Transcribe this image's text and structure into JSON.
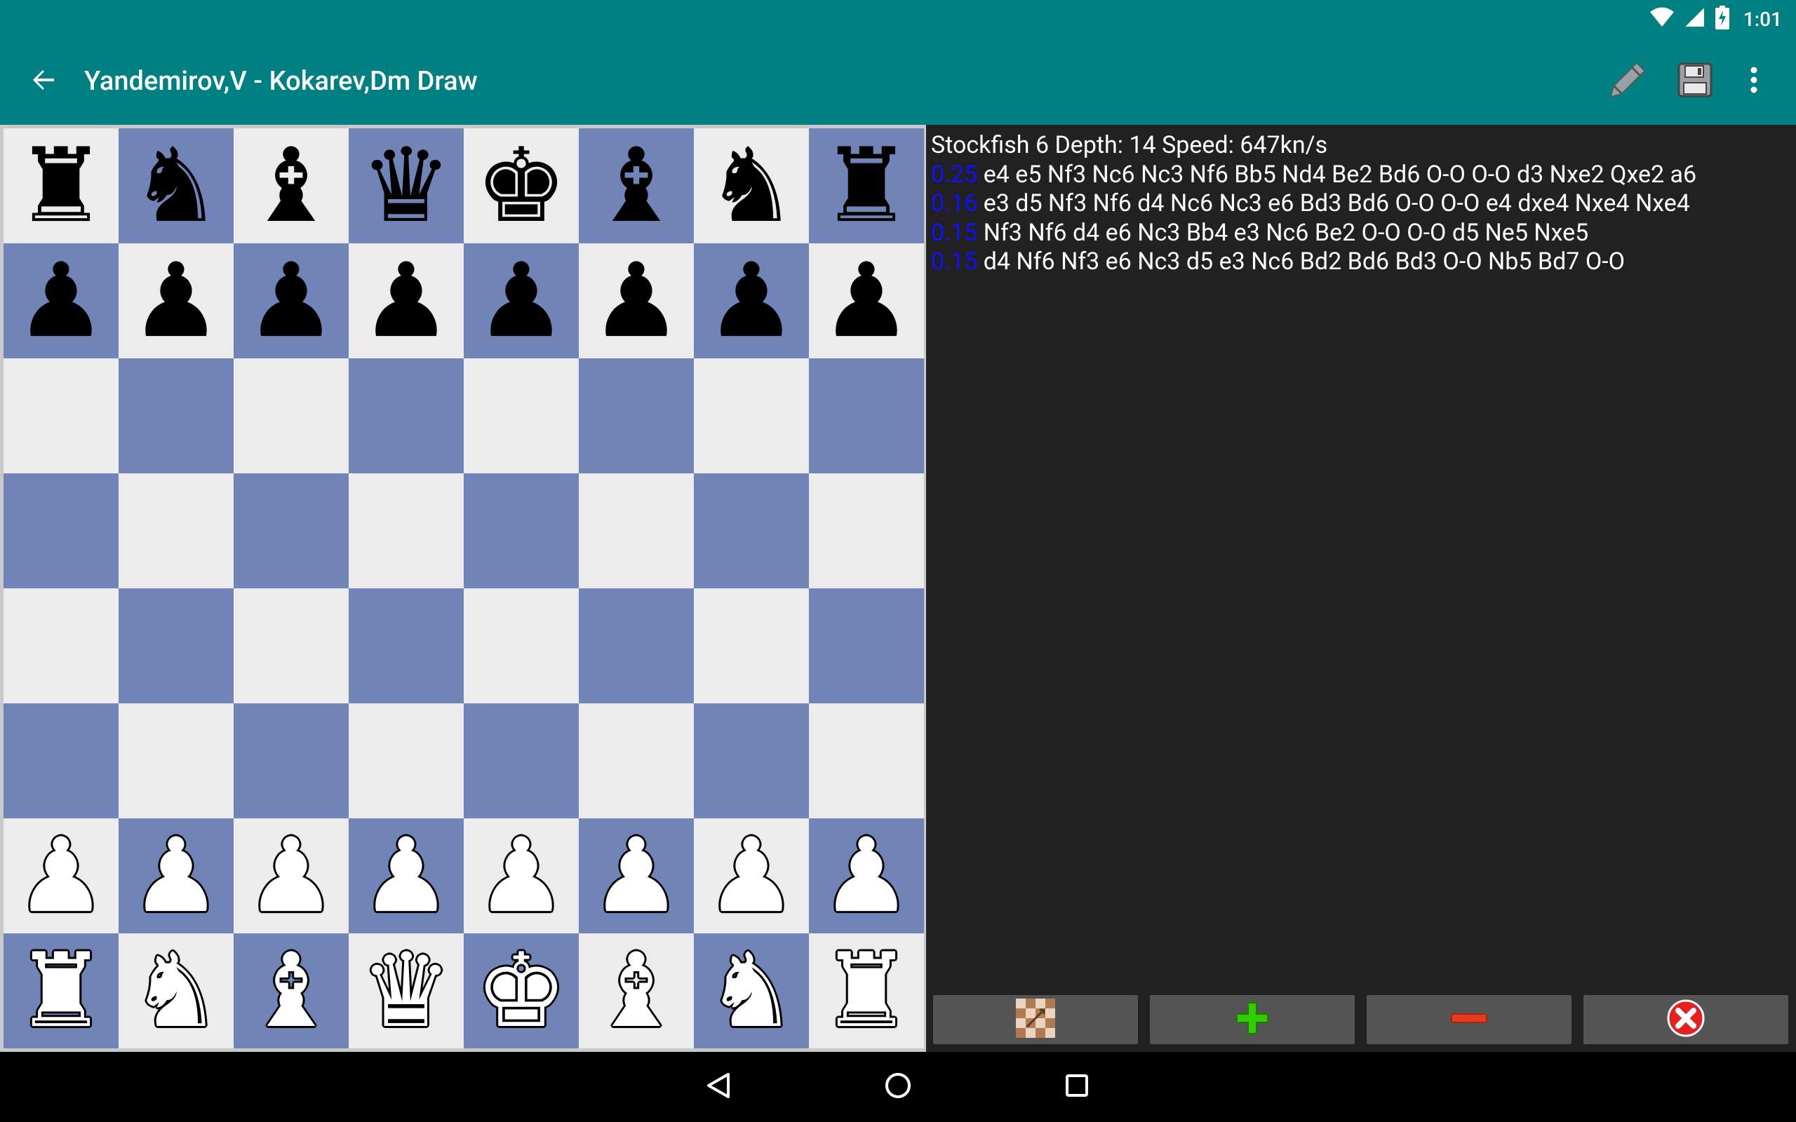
{
  "status_bar": {
    "time": "1:01",
    "icons": [
      "wifi-icon",
      "cellular-signal-icon",
      "battery-charging-icon"
    ]
  },
  "toolbar": {
    "back_icon": "arrow-back-icon",
    "title": "Yandemirov,V - Kokarev,Dm Draw",
    "actions": [
      "edit-pencil-icon",
      "save-floppy-icon",
      "more-vert-icon"
    ]
  },
  "board": {
    "ranks": [
      [
        "br",
        "bn",
        "bb",
        "bq",
        "bk",
        "bb",
        "bn",
        "br"
      ],
      [
        "bp",
        "bp",
        "bp",
        "bp",
        "bp",
        "bp",
        "bp",
        "bp"
      ],
      [
        "",
        "",
        "",
        "",
        "",
        "",
        "",
        ""
      ],
      [
        "",
        "",
        "",
        "",
        "",
        "",
        "",
        ""
      ],
      [
        "",
        "",
        "",
        "",
        "",
        "",
        "",
        ""
      ],
      [
        "",
        "",
        "",
        "",
        "",
        "",
        "",
        ""
      ],
      [
        "wp",
        "wp",
        "wp",
        "wp",
        "wp",
        "wp",
        "wp",
        "wp"
      ],
      [
        "wr",
        "wn",
        "wb",
        "wq",
        "wk",
        "wb",
        "wn",
        "wr"
      ]
    ],
    "colors": {
      "light": "#ececec",
      "dark": "#7084b8"
    }
  },
  "engine": {
    "header": "Stockfish 6 Depth: 14 Speed: 647kn/s",
    "lines": [
      {
        "score": "0.25",
        "moves": "e4 e5 Nf3 Nc6 Nc3 Nf6 Bb5 Nd4 Be2 Bd6 O-O O-O d3 Nxe2 Qxe2 a6"
      },
      {
        "score": "0.16",
        "moves": "e3 d5 Nf3 Nf6 d4 Nc6 Nc3 e6 Bd3 Bd6 O-O O-O e4 dxe4 Nxe4 Nxe4"
      },
      {
        "score": "0.15",
        "moves": "Nf3 Nf6 d4 e6 Nc3 Bb4 e3 Nc6 Be2 O-O O-O d5 Ne5 Nxe5"
      },
      {
        "score": "0.15",
        "moves": "d4 Nf6 Nf3 e6 Nc3 d5 e3 Nc6 Bd2 Bd6 Bd3 O-O Nb5 Bd7 O-O"
      }
    ],
    "score_color": "#1010ff"
  },
  "bottom_buttons": [
    {
      "icon": "board-flip-icon"
    },
    {
      "icon": "plus-icon",
      "color": "#33cc00"
    },
    {
      "icon": "minus-icon",
      "color": "#e83a1c"
    },
    {
      "icon": "close-x-icon",
      "color": "#e52020"
    }
  ],
  "nav_bar": [
    "back-triangle-icon",
    "home-circle-icon",
    "recents-square-icon"
  ],
  "colors": {
    "primary": "#008080",
    "panel_bg": "#212121",
    "button_bg": "#555555"
  }
}
